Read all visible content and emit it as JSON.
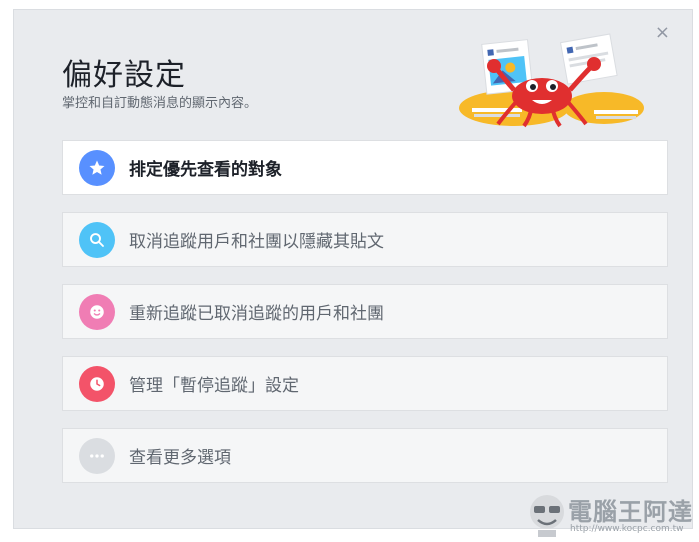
{
  "dialog": {
    "title": "偏好設定",
    "subtitle": "掌控和自訂動態消息的顯示內容。",
    "close_label": "×"
  },
  "options": [
    {
      "label": "排定優先查看的對象",
      "icon": "star-icon",
      "color": "#5890ff"
    },
    {
      "label": "取消追蹤用戶和社團以隱藏其貼文",
      "icon": "search-icon",
      "color": "#4fc3f7"
    },
    {
      "label": "重新追蹤已取消追蹤的用戶和社團",
      "icon": "smiley-icon",
      "color": "#f07db4"
    },
    {
      "label": "管理「暫停追蹤」設定",
      "icon": "clock-icon",
      "color": "#f35369"
    },
    {
      "label": "查看更多選項",
      "icon": "more-icon",
      "color": "#dadde1"
    }
  ],
  "watermark": {
    "title": "電腦王阿達",
    "url": "http://www.kocpc.com.tw"
  }
}
